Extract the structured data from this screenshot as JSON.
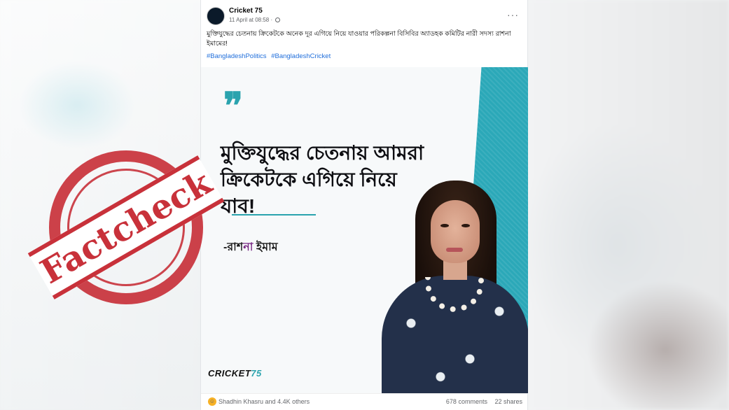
{
  "post": {
    "page_name": "Cricket 75",
    "timestamp": "11 April at 08:58 ·",
    "caption": "মুক্তিযুদ্ধের চেতনায় ক্রিকেটকে অনেক দূর এগিয়ে নিয়ে যাওয়ার পরিকল্পনা বিসিবির অ্যাডহক কমিটির নারী সদস্য রাশনা ইমামের!",
    "hashtags": [
      "#BangladeshPolitics",
      "#BangladeshCricket"
    ],
    "image": {
      "quote_mark": "❞",
      "quote_line1": "মুক্তিযুদ্ধের চেতনায় আমরা",
      "quote_line2": "ক্রিকেটকে এগিয়ে নিয়ে যাব!",
      "attribution_prefix": "-রাশ",
      "attribution_highlight": "না",
      "attribution_suffix": " ইমাম",
      "brand_logo_a": "CRICKET",
      "brand_logo_b": "75"
    },
    "footer": {
      "reactions": "Shadhin Khasru and 4.4K others",
      "comments": "678 comments",
      "shares": "22 shares"
    }
  },
  "stamp": {
    "label": "Factcheck"
  },
  "colors": {
    "accent_teal": "#2aa3ae",
    "stamp_red": "#c8313a",
    "link_blue": "#216fdb"
  }
}
